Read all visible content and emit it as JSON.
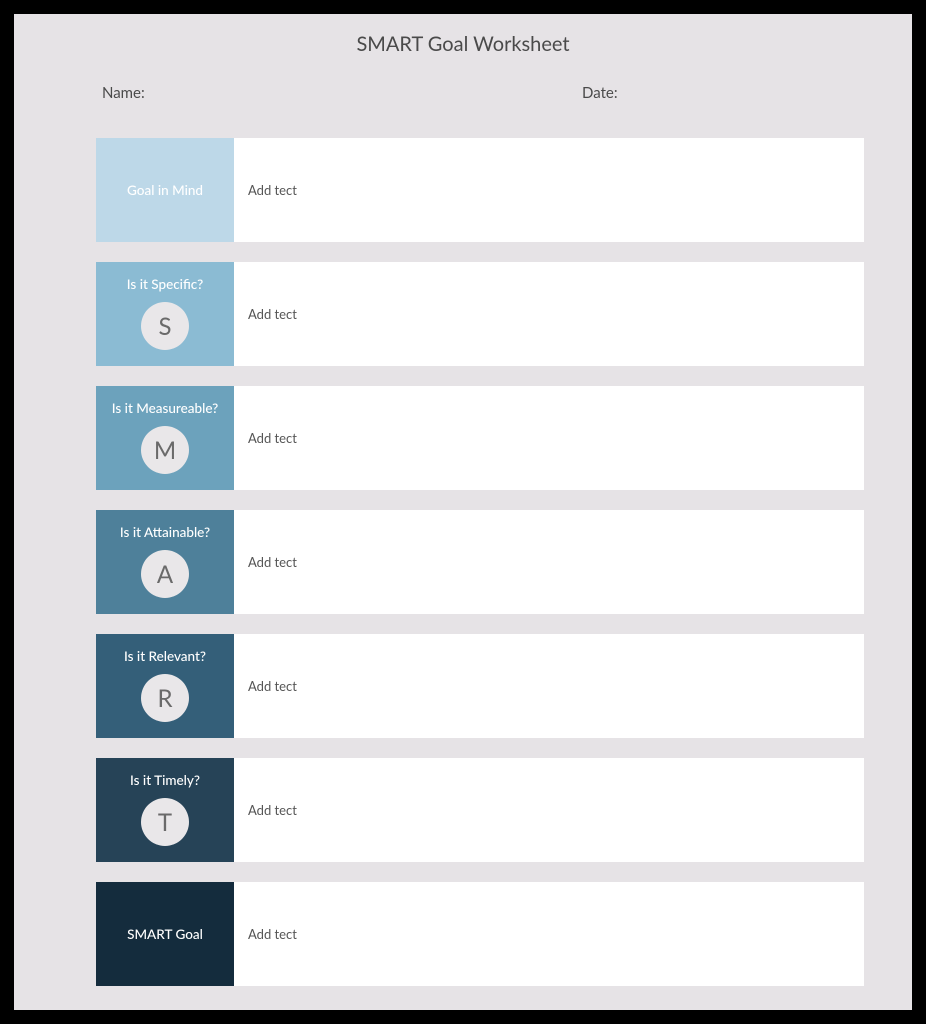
{
  "title": "SMART Goal Worksheet",
  "meta": {
    "name_label": "Name:",
    "date_label": "Date:"
  },
  "placeholder": "Add tect",
  "rows": [
    {
      "label": "Goal in Mind",
      "letter": "",
      "color": "c0"
    },
    {
      "label": "Is it Specific?",
      "letter": "S",
      "color": "c1"
    },
    {
      "label": "Is it Measureable?",
      "letter": "M",
      "color": "c2"
    },
    {
      "label": "Is it Attainable?",
      "letter": "A",
      "color": "c3"
    },
    {
      "label": "Is it Relevant?",
      "letter": "R",
      "color": "c4"
    },
    {
      "label": "Is it Timely?",
      "letter": "T",
      "color": "c5"
    },
    {
      "label": "SMART Goal",
      "letter": "",
      "color": "c6"
    }
  ]
}
